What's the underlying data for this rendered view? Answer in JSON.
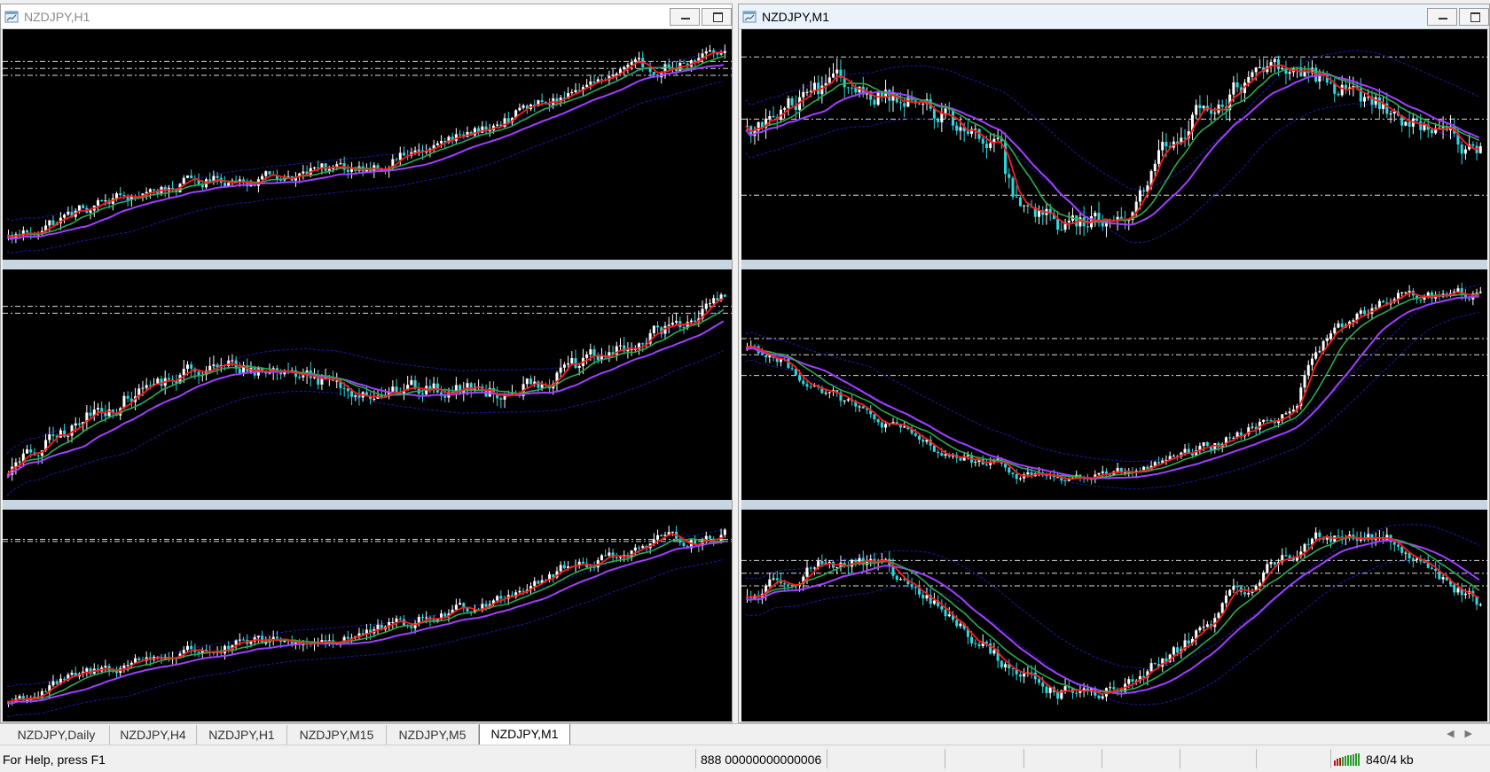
{
  "colors": {
    "background": "#000000",
    "bull_candle": "#ffffff",
    "bear_candle": "#2ed8e0",
    "ma_fast": "#ff1a1a",
    "ma_mid": "#2ea84f",
    "ma_slow": "#a040ff",
    "envelope": "#1a1aa8",
    "level_line": "#dcdcdc"
  },
  "windows": [
    {
      "title": "NZDJPY,H1",
      "state": "inactive",
      "icon": "chart-window-icon"
    },
    {
      "title": "NZDJPY,M1",
      "state": "active",
      "icon": "chart-window-icon"
    }
  ],
  "charts": [
    {
      "id": "left-top",
      "trend": "up",
      "levels": [
        0.14,
        0.17,
        0.2
      ]
    },
    {
      "id": "left-mid",
      "trend": "updown",
      "levels": [
        0.16,
        0.19
      ]
    },
    {
      "id": "left-bottom",
      "trend": "up",
      "levels": [
        0.14,
        0.15
      ]
    },
    {
      "id": "right-top",
      "trend": "range",
      "levels": [
        0.12,
        0.39,
        0.72
      ]
    },
    {
      "id": "right-mid",
      "trend": "dip",
      "levels": [
        0.3,
        0.37,
        0.46
      ]
    },
    {
      "id": "right-bottom",
      "trend": "wave",
      "levels": [
        0.24,
        0.3,
        0.36
      ]
    }
  ],
  "tabs": [
    {
      "label": "NZDJPY,Daily",
      "active": false
    },
    {
      "label": "NZDJPY,H4",
      "active": false
    },
    {
      "label": "NZDJPY,H1",
      "active": false
    },
    {
      "label": "NZDJPY,M15",
      "active": false
    },
    {
      "label": "NZDJPY,M5",
      "active": false
    },
    {
      "label": "NZDJPY,M1",
      "active": true
    }
  ],
  "tab_scroll": {
    "left": "◀",
    "right": "▶"
  },
  "status": {
    "help": "For Help, press F1",
    "account": "888 00000000000006",
    "traffic": "840/4 kb"
  }
}
